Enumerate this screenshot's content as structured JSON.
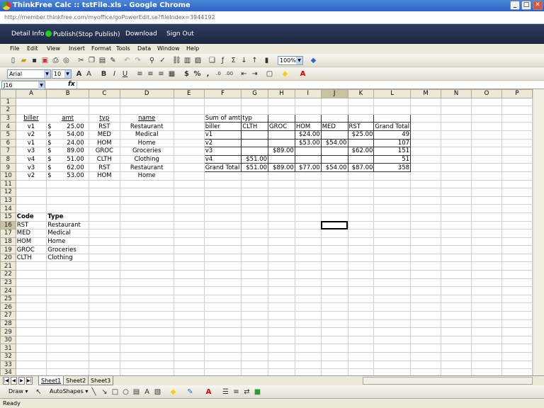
{
  "window": {
    "title": "ThinkFree Calc :: tstFile.xls - Google Chrome",
    "minimize": "_",
    "maximize": "□",
    "close": "✕"
  },
  "url": "http://member.thinkfree.com/myoffice/goPowerEdit.se?fileIndex=3944192",
  "nav": {
    "detail": "Detail Info",
    "publish": "Publish(Stop Publish)",
    "download": "Download",
    "signout": "Sign Out"
  },
  "menu": [
    "File",
    "Edit",
    "View",
    "Insert",
    "Format",
    "Tools",
    "Data",
    "Window",
    "Help"
  ],
  "toolbar": {
    "zoom": "100%"
  },
  "format": {
    "font": "Arial",
    "size": "10"
  },
  "cell_ref": "J16",
  "fx": "fx",
  "columns": [
    "A",
    "B",
    "C",
    "D",
    "E",
    "F",
    "G",
    "H",
    "I",
    "J",
    "K",
    "L",
    "M",
    "N",
    "O",
    "P"
  ],
  "rows": [
    [
      "",
      "",
      "",
      "",
      "",
      "",
      "",
      "",
      "",
      "",
      "",
      "",
      "",
      "",
      "",
      ""
    ],
    [
      "",
      "",
      "",
      "",
      "",
      "",
      "",
      "",
      "",
      "",
      "",
      "",
      "",
      "",
      "",
      ""
    ],
    [
      "biller",
      "amt",
      "typ",
      "name",
      "",
      "Sum of amt",
      "typ",
      "",
      "",
      "",
      "",
      "",
      "",
      "",
      "",
      ""
    ],
    [
      "v1",
      "$        25.00",
      "RST",
      "Restaurant",
      "",
      "biller",
      "CLTH",
      "GROC",
      "HOM",
      "MED",
      "RST",
      "Grand Total",
      "",
      "",
      "",
      ""
    ],
    [
      "v2",
      "$        54.00",
      "MED",
      "Medical",
      "",
      "v1",
      "",
      "",
      "$24.00",
      "",
      "$25.00",
      "49",
      "",
      "",
      "",
      ""
    ],
    [
      "v1",
      "$        24.00",
      "HOM",
      "Home",
      "",
      "v2",
      "",
      "",
      "$53.00",
      "$54.00",
      "",
      "107",
      "",
      "",
      "",
      ""
    ],
    [
      "v3",
      "$        89.00",
      "GROC",
      "Groceries",
      "",
      "v3",
      "",
      "$89.00",
      "",
      "",
      "$62.00",
      "151",
      "",
      "",
      "",
      ""
    ],
    [
      "v4",
      "$        51.00",
      "CLTH",
      "Clothing",
      "",
      "v4",
      "$51.00",
      "",
      "",
      "",
      "",
      "51",
      "",
      "",
      "",
      ""
    ],
    [
      "v3",
      "$        62.00",
      "RST",
      "Restaurant",
      "",
      "Grand Total",
      "$51.00",
      "$89.00",
      "$77.00",
      "$54.00",
      "$87.00",
      "358",
      "",
      "",
      "",
      ""
    ],
    [
      "v2",
      "$        53.00",
      "HOM",
      "Home",
      "",
      "",
      "",
      "",
      "",
      "",
      "",
      "",
      "",
      "",
      "",
      ""
    ],
    [
      "",
      "",
      "",
      "",
      "",
      "",
      "",
      "",
      "",
      "",
      "",
      "",
      "",
      "",
      "",
      ""
    ],
    [
      "",
      "",
      "",
      "",
      "",
      "",
      "",
      "",
      "",
      "",
      "",
      "",
      "",
      "",
      "",
      ""
    ],
    [
      "",
      "",
      "",
      "",
      "",
      "",
      "",
      "",
      "",
      "",
      "",
      "",
      "",
      "",
      "",
      ""
    ],
    [
      "",
      "",
      "",
      "",
      "",
      "",
      "",
      "",
      "",
      "",
      "",
      "",
      "",
      "",
      "",
      ""
    ],
    [
      "Code",
      "Type",
      "",
      "",
      "",
      "",
      "",
      "",
      "",
      "",
      "",
      "",
      "",
      "",
      "",
      ""
    ],
    [
      "RST",
      "Restaurant",
      "",
      "",
      "",
      "",
      "",
      "",
      "",
      "",
      "",
      "",
      "",
      "",
      "",
      ""
    ],
    [
      "MED",
      "Medical",
      "",
      "",
      "",
      "",
      "",
      "",
      "",
      "",
      "",
      "",
      "",
      "",
      "",
      ""
    ],
    [
      "HOM",
      "Home",
      "",
      "",
      "",
      "",
      "",
      "",
      "",
      "",
      "",
      "",
      "",
      "",
      "",
      ""
    ],
    [
      "GROC",
      "Groceries",
      "",
      "",
      "",
      "",
      "",
      "",
      "",
      "",
      "",
      "",
      "",
      "",
      "",
      ""
    ],
    [
      "CLTH",
      "Clothing",
      "",
      "",
      "",
      "",
      "",
      "",
      "",
      "",
      "",
      "",
      "",
      "",
      "",
      ""
    ]
  ],
  "total_rows": 34,
  "sheet_tabs": [
    "Sheet1",
    "Sheet2",
    "Sheet3"
  ],
  "drawbar": {
    "draw": "Draw ▾",
    "autoshapes": "AutoShapes ▾"
  },
  "status": "Ready"
}
